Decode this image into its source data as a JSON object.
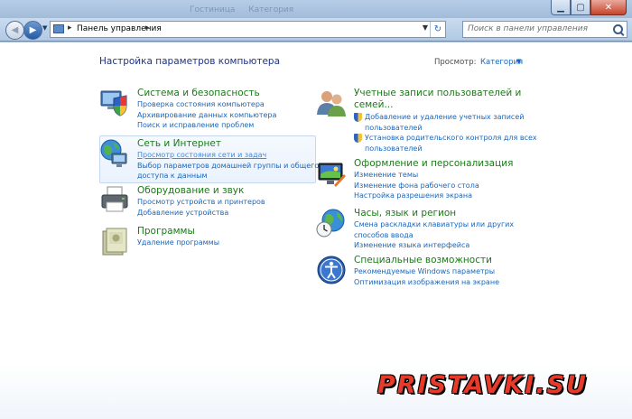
{
  "window": {
    "ghost_tabs": [
      "Гостиница",
      "Категория"
    ],
    "minimize_label": "▁",
    "maximize_label": "▢",
    "close_label": "✕"
  },
  "address": {
    "breadcrumb": "Панель управления",
    "search_placeholder": "Поиск в панели управления"
  },
  "header": {
    "title": "Настройка параметров компьютера",
    "view_label": "Просмотр:",
    "view_value": "Категория"
  },
  "categories": [
    {
      "title": "Система и безопасность",
      "icon": "shield-monitor-icon",
      "links": [
        "Проверка состояния компьютера",
        "Архивирование данных компьютера",
        "Поиск и исправление проблем"
      ]
    },
    {
      "title": "Сеть и Интернет",
      "icon": "network-globe-icon",
      "links": [
        "Просмотр состояния сети и задач",
        "Выбор параметров домашней группы и общего",
        "доступа к данным"
      ]
    },
    {
      "title": "Оборудование и звук",
      "icon": "printer-icon",
      "links": [
        "Просмотр устройств и принтеров",
        "Добавление устройства"
      ]
    },
    {
      "title": "Программы",
      "icon": "programs-icon",
      "links": [
        "Удаление программы"
      ]
    },
    {
      "title_line1": "Учетные записи пользователей и",
      "title_line2": "семей...",
      "icon": "users-icon",
      "links": [
        "Добавление и удаление учетных записей",
        "пользователей",
        "Установка родительского контроля для всех",
        "пользователей"
      ]
    },
    {
      "title": "Оформление и персонализация",
      "icon": "personalization-icon",
      "links": [
        "Изменение темы",
        "Изменение фона рабочего стола",
        "Настройка разрешения экрана"
      ]
    },
    {
      "title": "Часы, язык и регион",
      "icon": "clock-globe-icon",
      "links": [
        "Смена раскладки клавиатуры или других",
        "способов ввода",
        "Изменение языка интерфейса"
      ]
    },
    {
      "title": "Специальные возможности",
      "icon": "accessibility-icon",
      "links": [
        "Рекомендуемые Windows параметры",
        "Оптимизация изображения на экране"
      ]
    }
  ],
  "watermark": "PRISTAVKI.SU",
  "colors": {
    "category_title": "#1b7a18",
    "link": "#1866bd",
    "page_title": "#1e3287",
    "watermark": "#e63a2b"
  }
}
